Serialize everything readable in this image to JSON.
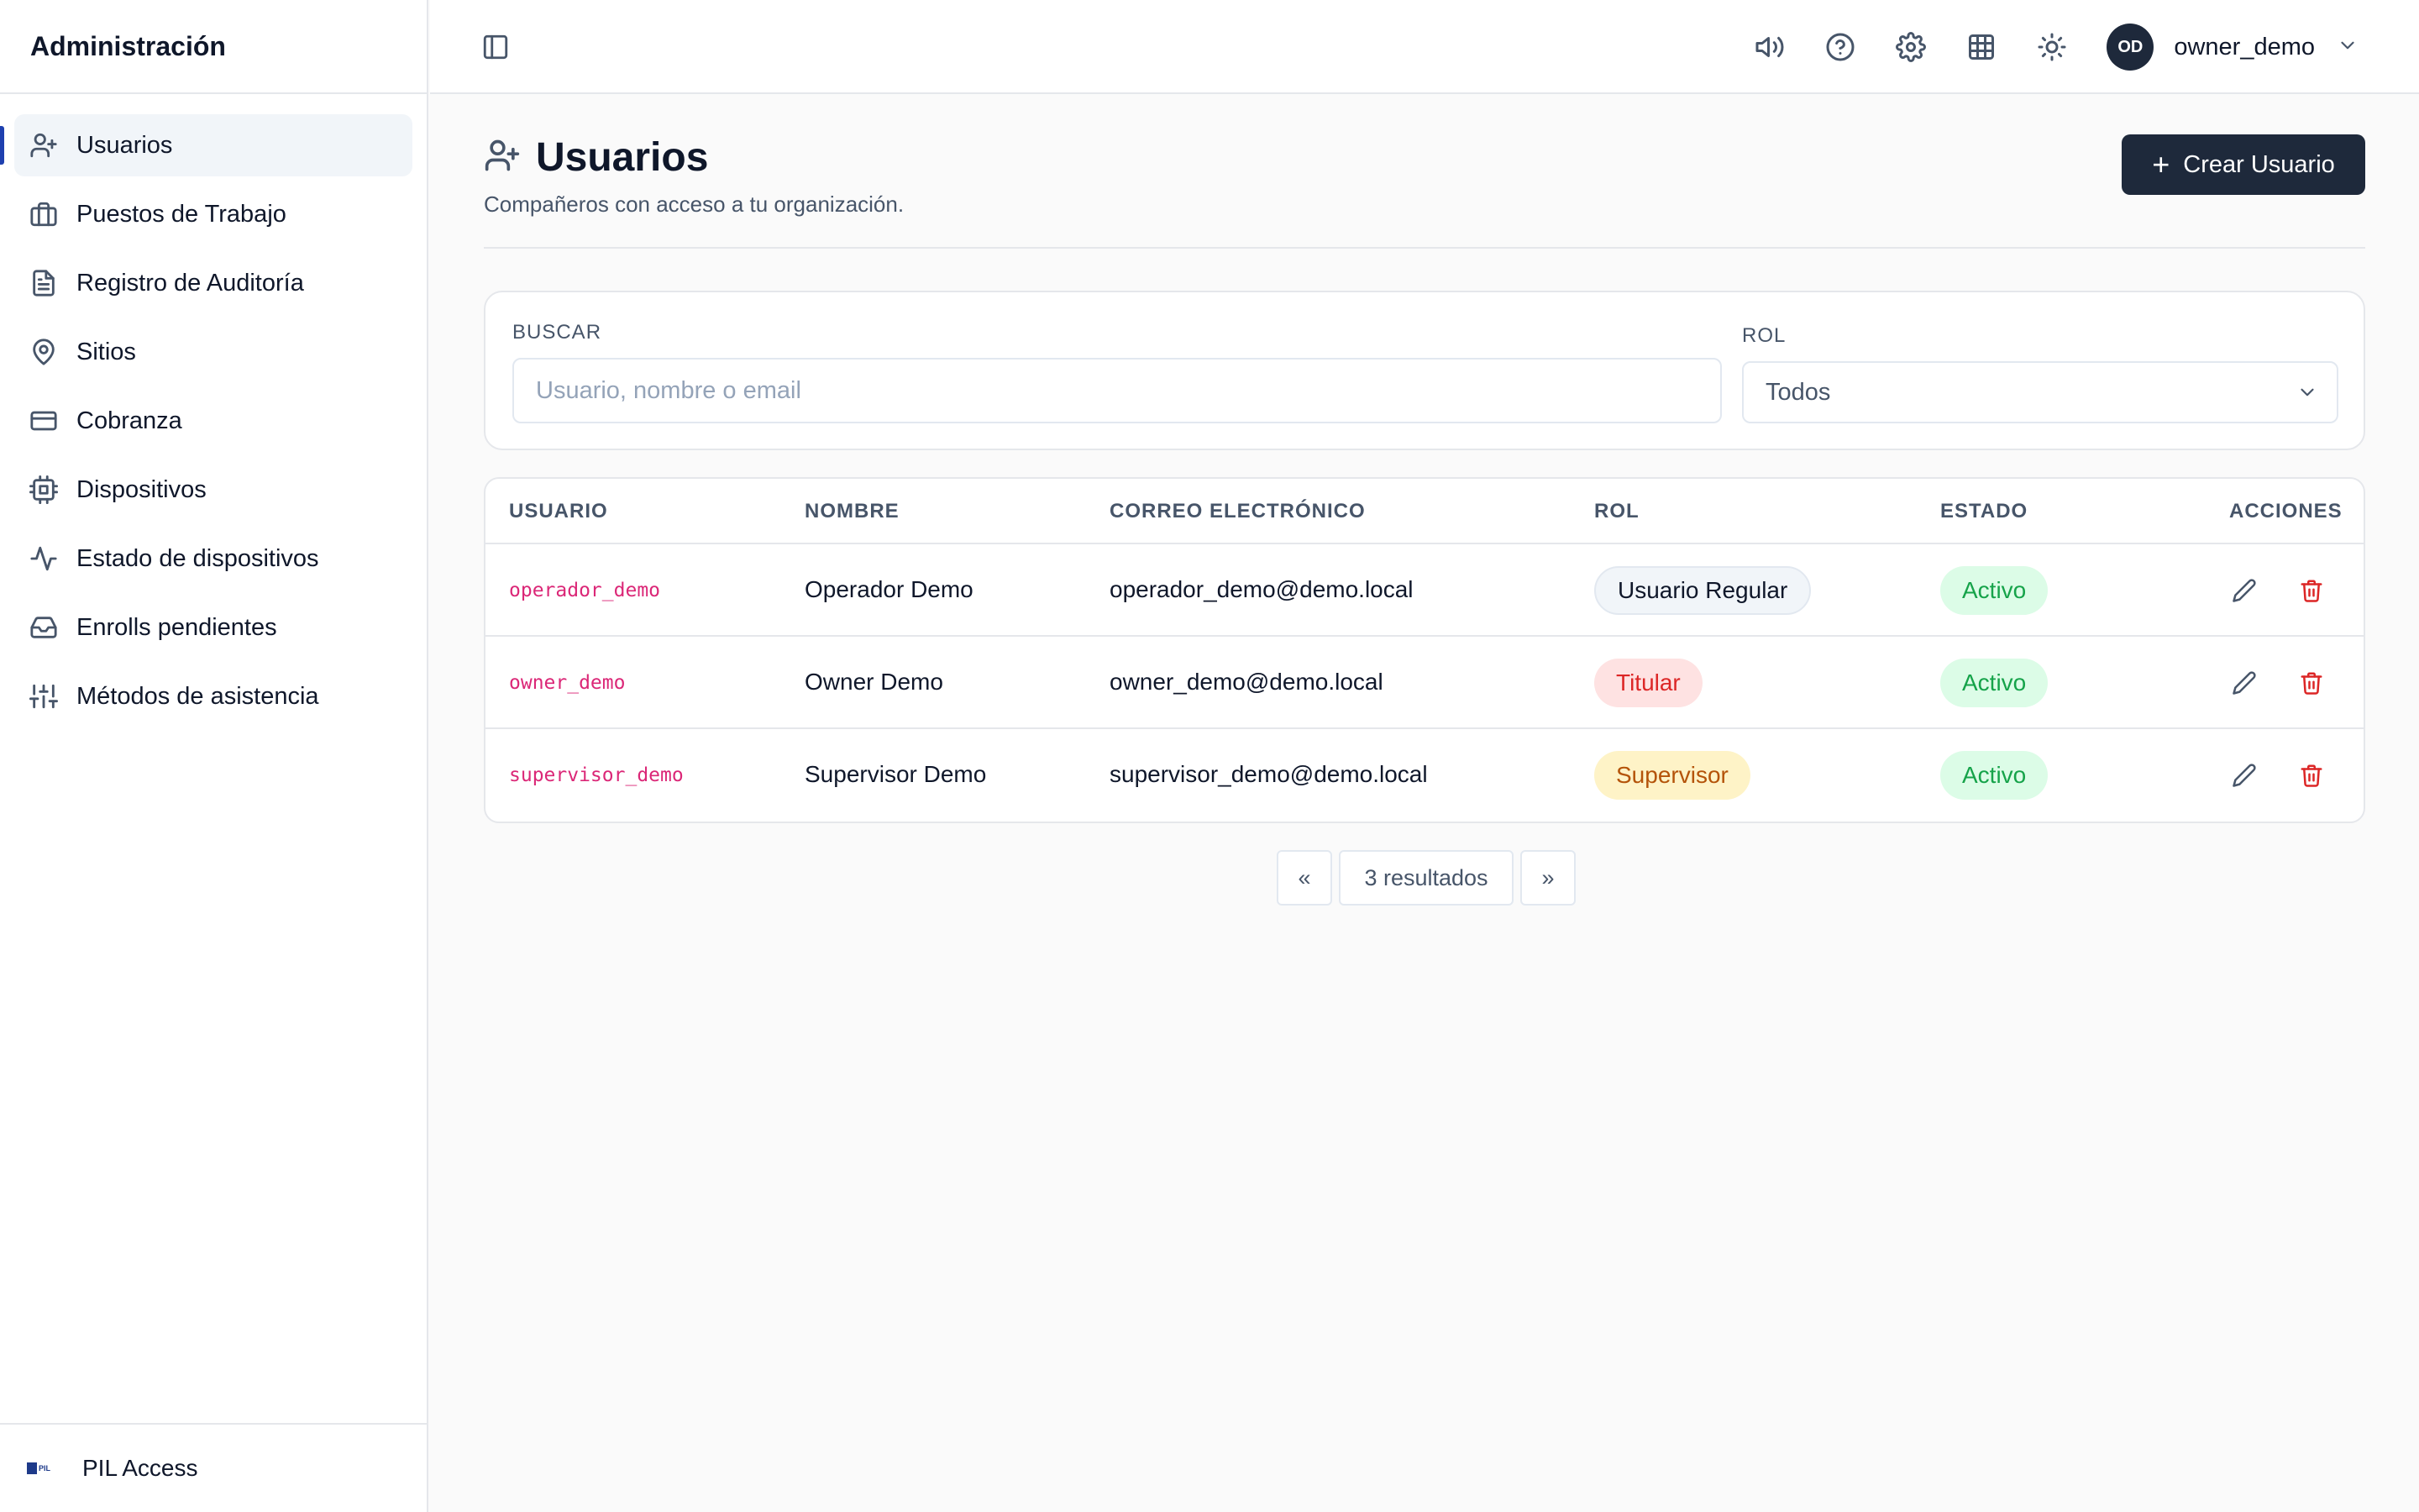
{
  "sidebar": {
    "title": "Administración",
    "items": [
      {
        "label": "Usuarios",
        "icon": "user-plus-icon"
      },
      {
        "label": "Puestos de Trabajo",
        "icon": "briefcase-icon"
      },
      {
        "label": "Registro de Auditoría",
        "icon": "file-text-icon"
      },
      {
        "label": "Sitios",
        "icon": "map-pin-icon"
      },
      {
        "label": "Cobranza",
        "icon": "credit-card-icon"
      },
      {
        "label": "Dispositivos",
        "icon": "cpu-icon"
      },
      {
        "label": "Estado de dispositivos",
        "icon": "activity-icon"
      },
      {
        "label": "Enrolls pendientes",
        "icon": "inbox-icon"
      },
      {
        "label": "Métodos de asistencia",
        "icon": "sliders-icon"
      }
    ],
    "active_item": "Usuarios",
    "footer": {
      "brand_label": "PIL Access",
      "logo_text": "PIL"
    }
  },
  "topbar": {
    "icons": [
      "volume-icon",
      "help-circle-icon",
      "settings-icon",
      "grid-icon",
      "sun-icon"
    ],
    "user": {
      "initials": "OD",
      "name": "owner_demo"
    }
  },
  "page": {
    "title": "Usuarios",
    "subtitle": "Compañeros con acceso a tu organización.",
    "create_button": "Crear Usuario"
  },
  "filters": {
    "search_label": "BUSCAR",
    "search_placeholder": "Usuario, nombre o email",
    "search_value": "",
    "role_label": "ROL",
    "role_value": "Todos"
  },
  "table": {
    "headers": {
      "user": "USUARIO",
      "name": "NOMBRE",
      "email": "CORREO ELECTRÓNICO",
      "role": "ROL",
      "status": "ESTADO",
      "actions": "ACCIONES"
    },
    "rows": [
      {
        "user": "operador_demo",
        "name": "Operador Demo",
        "email": "operador_demo@demo.local",
        "role": "Usuario Regular",
        "status": "Activo"
      },
      {
        "user": "owner_demo",
        "name": "Owner Demo",
        "email": "owner_demo@demo.local",
        "role": "Titular",
        "status": "Activo"
      },
      {
        "user": "supervisor_demo",
        "name": "Supervisor Demo",
        "email": "supervisor_demo@demo.local",
        "role": "Supervisor",
        "status": "Activo"
      }
    ]
  },
  "pagination": {
    "prev": "«",
    "info": "3 resultados",
    "next": "»"
  },
  "colors": {
    "accent": "#1e293b",
    "active_indicator": "#1e40af",
    "username": "#db2777",
    "status_active_bg": "#dcfce7",
    "status_active_text": "#16a34a",
    "role_titular_bg": "#fee2e2",
    "role_titular_text": "#dc2626",
    "role_supervisor_bg": "#fef3c7",
    "role_supervisor_text": "#b45309",
    "delete": "#dc2626"
  }
}
